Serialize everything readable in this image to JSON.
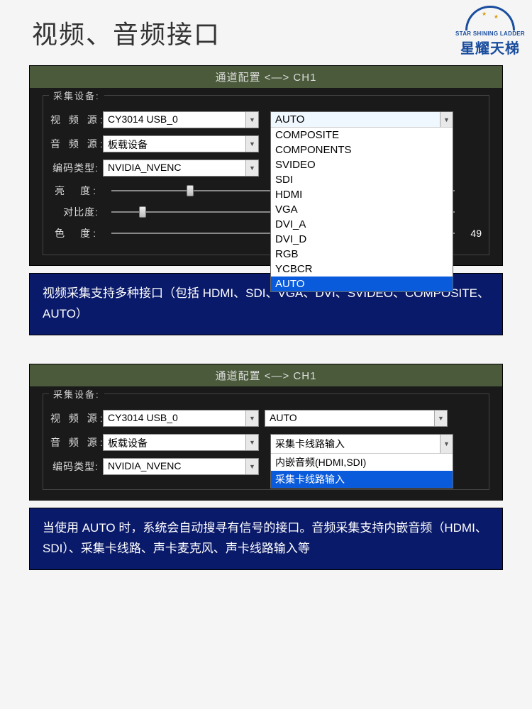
{
  "page_title": "视频、音频接口",
  "logo": {
    "small": "STAR SHINING LADDER",
    "big": "星耀天梯"
  },
  "panel1": {
    "title": "通道配置 <—> CH1",
    "legend": "采集设备:",
    "video_label": "视 频 源:",
    "video_value": "CY3014 USB_0",
    "dropdown_header": "AUTO",
    "dropdown_items": [
      "COMPOSITE",
      "COMPONENTS",
      "SVIDEO",
      "SDI",
      "HDMI",
      "VGA",
      "DVI_A",
      "DVI_D",
      "RGB",
      "YCBCR",
      "AUTO"
    ],
    "audio_label": "音 频 源:",
    "audio_value": "板载设备",
    "enc_label": "编码类型:",
    "enc_value": "NVIDIA_NVENC",
    "bright_label": "亮　度:",
    "contrast_label": "对比度:",
    "hue_label": "色　度:",
    "hue_value": "49"
  },
  "note1": "视频采集支持多种接口（包括 HDMI、SDI、VGA、DVI、SVIDEO、COMPOSITE、AUTO）",
  "panel2": {
    "title": "通道配置 <—> CH1",
    "legend": "采集设备:",
    "video_label": "视 频 源:",
    "video_value": "CY3014 USB_0",
    "video_mode": "AUTO",
    "audio_label": "音 频 源:",
    "audio_value": "板载设备",
    "dropdown_header": "采集卡线路输入",
    "dropdown_items": [
      "内嵌音频(HDMI,SDI)",
      "采集卡线路输入"
    ],
    "enc_label": "编码类型:",
    "enc_value": "NVIDIA_NVENC"
  },
  "note2": "当使用 AUTO 时，系统会自动搜寻有信号的接口。音频采集支持内嵌音频（HDMI、SDI）、采集卡线路、声卡麦克风、声卡线路输入等"
}
